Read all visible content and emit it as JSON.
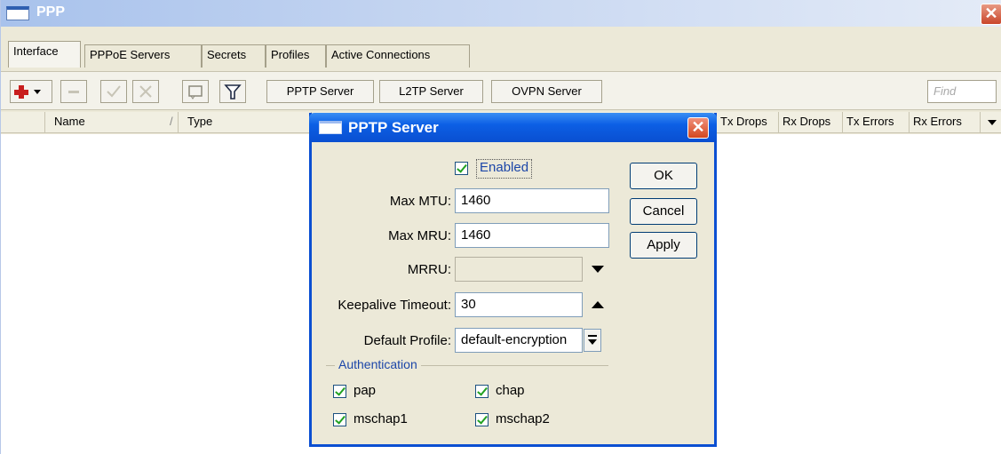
{
  "window": {
    "title": "PPP",
    "close_glyph": "✕"
  },
  "tabs": [
    "Interface",
    "PPPoE Servers",
    "Secrets",
    "Profiles",
    "Active Connections"
  ],
  "toolbar": {
    "icons": [
      "add-icon",
      "remove-icon",
      "enable-icon",
      "disable-icon",
      "comment-icon",
      "filter-icon"
    ],
    "buttons": [
      "PPTP Server",
      "L2TP Server",
      "OVPN Server"
    ],
    "find_placeholder": "Find"
  },
  "columns": [
    "Name",
    "Type",
    "Tx Drops",
    "Rx Drops",
    "Tx Errors",
    "Rx Errors"
  ],
  "dialog": {
    "title": "PPTP Server",
    "close_glyph": "✕",
    "enabled_label": "Enabled",
    "enabled_checked": true,
    "fields": {
      "max_mtu_label": "Max MTU:",
      "max_mtu_value": "1460",
      "max_mru_label": "Max MRU:",
      "max_mru_value": "1460",
      "mrru_label": "MRRU:",
      "mrru_value": "",
      "keepalive_label": "Keepalive Timeout:",
      "keepalive_value": "30",
      "default_profile_label": "Default Profile:",
      "default_profile_value": "default-encryption"
    },
    "authentication": {
      "title": "Authentication",
      "options": [
        {
          "label": "pap",
          "checked": true
        },
        {
          "label": "chap",
          "checked": true
        },
        {
          "label": "mschap1",
          "checked": true
        },
        {
          "label": "mschap2",
          "checked": true
        }
      ]
    },
    "buttons": {
      "ok": "OK",
      "cancel": "Cancel",
      "apply": "Apply"
    }
  },
  "colors": {
    "xp_title_blue": "#0a4fd0",
    "window_bg": "#ece9d8",
    "check_green": "#21a121",
    "add_red": "#c81e1e"
  }
}
